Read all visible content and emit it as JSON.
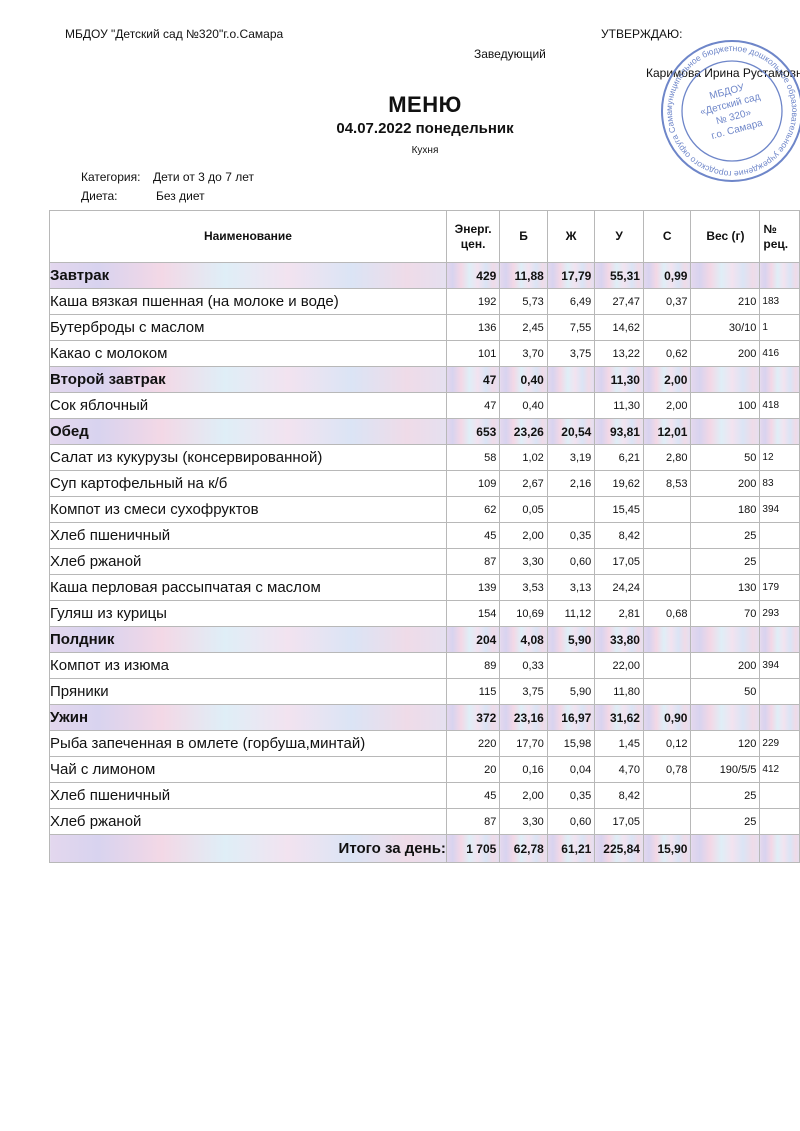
{
  "header": {
    "org": "МБДОУ \"Детский сад №320\"г.о.Самара",
    "approve": "УТВЕРЖДАЮ:",
    "position": "Заведующий",
    "head_name": "Каримова Ирина Рустамовна"
  },
  "title": "МЕНЮ",
  "subtitle": "04.07.2022  понедельник",
  "kitchen": "Кухня",
  "meta": {
    "category_label": "Категория:",
    "category_value": "Дети от 3 до 7 лет",
    "diet_label": "Диета:",
    "diet_value": "Без диет"
  },
  "stamp": {
    "outer_text": "муниципальное бюджетное дошкольное образовательное учреждение городского округа Самара",
    "line1": "МБДОУ",
    "line2": "«Детский сад",
    "line3": "№ 320»",
    "line4": "г.о. Самара"
  },
  "table": {
    "headers": {
      "name": "Наименование",
      "energy": "Энерг. цен.",
      "b": "Б",
      "zh": "Ж",
      "u": "У",
      "s": "С",
      "weight": "Вес (г)",
      "recipe": "№ рец."
    },
    "rows": [
      {
        "type": "section",
        "name": "Завтрак",
        "e": "429",
        "b": "11,88",
        "zh": "17,79",
        "u": "55,31",
        "s": "0,99",
        "w": "",
        "r": ""
      },
      {
        "type": "item",
        "name": "Каша вязкая пшенная (на молоке и воде)",
        "e": "192",
        "b": "5,73",
        "zh": "6,49",
        "u": "27,47",
        "s": "0,37",
        "w": "210",
        "r": "183"
      },
      {
        "type": "item",
        "name": "Бутерброды с маслом",
        "e": "136",
        "b": "2,45",
        "zh": "7,55",
        "u": "14,62",
        "s": "",
        "w": "30/10",
        "r": "1"
      },
      {
        "type": "item",
        "name": "Какао с молоком",
        "e": "101",
        "b": "3,70",
        "zh": "3,75",
        "u": "13,22",
        "s": "0,62",
        "w": "200",
        "r": "416"
      },
      {
        "type": "section",
        "name": "Второй завтрак",
        "e": "47",
        "b": "0,40",
        "zh": "",
        "u": "11,30",
        "s": "2,00",
        "w": "",
        "r": ""
      },
      {
        "type": "item",
        "name": "Сок яблочный",
        "e": "47",
        "b": "0,40",
        "zh": "",
        "u": "11,30",
        "s": "2,00",
        "w": "100",
        "r": "418"
      },
      {
        "type": "section",
        "name": "Обед",
        "e": "653",
        "b": "23,26",
        "zh": "20,54",
        "u": "93,81",
        "s": "12,01",
        "w": "",
        "r": ""
      },
      {
        "type": "item",
        "name": "Салат из кукурузы (консервированной)",
        "e": "58",
        "b": "1,02",
        "zh": "3,19",
        "u": "6,21",
        "s": "2,80",
        "w": "50",
        "r": "12"
      },
      {
        "type": "item",
        "name": "Суп картофельный на к/б",
        "e": "109",
        "b": "2,67",
        "zh": "2,16",
        "u": "19,62",
        "s": "8,53",
        "w": "200",
        "r": "83"
      },
      {
        "type": "item",
        "name": "Компот из смеси сухофруктов",
        "e": "62",
        "b": "0,05",
        "zh": "",
        "u": "15,45",
        "s": "",
        "w": "180",
        "r": "394"
      },
      {
        "type": "item",
        "name": "Хлеб пшеничный",
        "e": "45",
        "b": "2,00",
        "zh": "0,35",
        "u": "8,42",
        "s": "",
        "w": "25",
        "r": ""
      },
      {
        "type": "item",
        "name": "Хлеб ржаной",
        "e": "87",
        "b": "3,30",
        "zh": "0,60",
        "u": "17,05",
        "s": "",
        "w": "25",
        "r": ""
      },
      {
        "type": "item",
        "name": "Каша перловая рассыпчатая с маслом",
        "e": "139",
        "b": "3,53",
        "zh": "3,13",
        "u": "24,24",
        "s": "",
        "w": "130",
        "r": "179"
      },
      {
        "type": "item",
        "name": "Гуляш из курицы",
        "e": "154",
        "b": "10,69",
        "zh": "11,12",
        "u": "2,81",
        "s": "0,68",
        "w": "70",
        "r": "293"
      },
      {
        "type": "section",
        "name": "Полдник",
        "e": "204",
        "b": "4,08",
        "zh": "5,90",
        "u": "33,80",
        "s": "",
        "w": "",
        "r": ""
      },
      {
        "type": "item",
        "name": "Компот из изюма",
        "e": "89",
        "b": "0,33",
        "zh": "",
        "u": "22,00",
        "s": "",
        "w": "200",
        "r": "394"
      },
      {
        "type": "item",
        "name": "Пряники",
        "e": "115",
        "b": "3,75",
        "zh": "5,90",
        "u": "11,80",
        "s": "",
        "w": "50",
        "r": ""
      },
      {
        "type": "section",
        "name": "Ужин",
        "e": "372",
        "b": "23,16",
        "zh": "16,97",
        "u": "31,62",
        "s": "0,90",
        "w": "",
        "r": ""
      },
      {
        "type": "item",
        "name": "Рыба запеченная в омлете (горбуша,минтай)",
        "e": "220",
        "b": "17,70",
        "zh": "15,98",
        "u": "1,45",
        "s": "0,12",
        "w": "120",
        "r": "229"
      },
      {
        "type": "item",
        "name": "Чай с лимоном",
        "e": "20",
        "b": "0,16",
        "zh": "0,04",
        "u": "4,70",
        "s": "0,78",
        "w": "190/5/5",
        "r": "412"
      },
      {
        "type": "item",
        "name": "Хлеб пшеничный",
        "e": "45",
        "b": "2,00",
        "zh": "0,35",
        "u": "8,42",
        "s": "",
        "w": "25",
        "r": ""
      },
      {
        "type": "item",
        "name": "Хлеб ржаной",
        "e": "87",
        "b": "3,30",
        "zh": "0,60",
        "u": "17,05",
        "s": "",
        "w": "25",
        "r": ""
      }
    ],
    "total": {
      "label": "Итого за день:",
      "e": "1 705",
      "b": "62,78",
      "zh": "61,21",
      "u": "225,84",
      "s": "15,90",
      "w": "",
      "r": ""
    }
  }
}
